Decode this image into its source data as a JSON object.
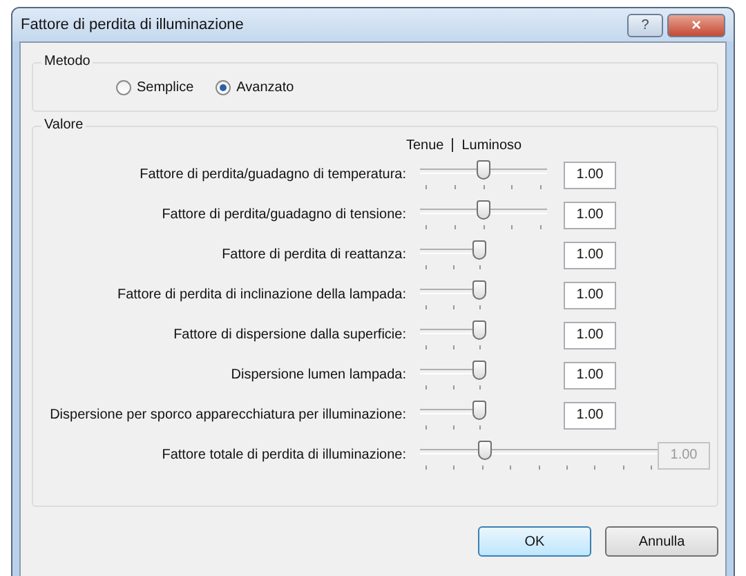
{
  "window": {
    "title": "Fattore di perdita di illuminazione",
    "help_button": "?",
    "close_button": "×"
  },
  "method": {
    "title": "Metodo",
    "options": [
      {
        "label": "Semplice",
        "selected": false
      },
      {
        "label": "Avanzato",
        "selected": true
      }
    ]
  },
  "values": {
    "title": "Valore",
    "scale_left": "Tenue",
    "scale_right": "Luminoso",
    "rows": [
      {
        "label": "Fattore di perdita/guadagno di temperatura:",
        "kind": "full",
        "level": 0.5,
        "value": "1.00",
        "disabled": false
      },
      {
        "label": "Fattore di perdita/guadagno di tensione:",
        "kind": "full",
        "level": 0.5,
        "value": "1.00",
        "disabled": false
      },
      {
        "label": "Fattore di perdita di reattanza:",
        "kind": "short",
        "level": 1,
        "value": "1.00",
        "disabled": false
      },
      {
        "label": "Fattore di perdita di inclinazione della lampada:",
        "kind": "short",
        "level": 1,
        "value": "1.00",
        "disabled": false
      },
      {
        "label": "Fattore di dispersione dalla superficie:",
        "kind": "short",
        "level": 1,
        "value": "1.00",
        "disabled": false
      },
      {
        "label": "Dispersione lumen lampada:",
        "kind": "short",
        "level": 1,
        "value": "1.00",
        "disabled": false
      },
      {
        "label": "Dispersione per sporco apparecchiatura per illuminazione:",
        "kind": "short",
        "level": 1,
        "value": "1.00",
        "disabled": false
      },
      {
        "label": "Fattore totale di perdita di illuminazione:",
        "kind": "long",
        "level": 0.26,
        "value": "1.00",
        "disabled": true
      }
    ]
  },
  "buttons": [
    {
      "label": "OK",
      "default": true
    },
    {
      "label": "Annulla",
      "default": false
    }
  ]
}
